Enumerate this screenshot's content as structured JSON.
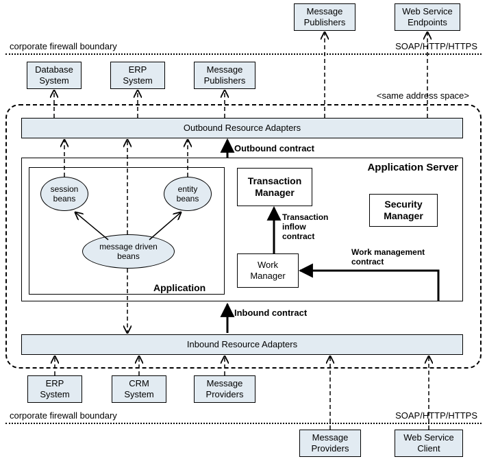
{
  "external_top": {
    "msg_pub": "Message\nPublishers",
    "ws_endpoints": "Web Service\nEndpoints"
  },
  "firewall_top_label": "corporate firewall boundary",
  "soap_label_top": "SOAP/HTTP/HTTPS",
  "inside_top": {
    "db": "Database\nSystem",
    "erp": "ERP\nSystem",
    "msg_pub": "Message\nPublishers"
  },
  "same_addr_space": "<same address space>",
  "outbound_adapters": "Outbound Resource Adapters",
  "outbound_contract": "Outbound contract",
  "app_server_label": "Application Server",
  "app": {
    "session_beans": "session\nbeans",
    "entity_beans": "entity\nbeans",
    "mdb": "message driven\nbeans",
    "label": "Application"
  },
  "txn_mgr": "Transaction\nManager",
  "txn_inflow_contract": "Transaction\ninflow\ncontract",
  "security_mgr": "Security\nManager",
  "work_mgr": "Work\nManager",
  "work_mgmt_contract": "Work management\ncontract",
  "inbound_contract": "Inbound contract",
  "inbound_adapters": "Inbound Resource Adapters",
  "inside_bottom": {
    "erp": "ERP\nSystem",
    "crm": "CRM\nSystem",
    "msg_prov": "Message\nProviders"
  },
  "firewall_bottom_label": "corporate firewall boundary",
  "soap_label_bottom": "SOAP/HTTP/HTTPS",
  "external_bottom": {
    "msg_prov": "Message\nProviders",
    "ws_client": "Web Service\nClient"
  }
}
